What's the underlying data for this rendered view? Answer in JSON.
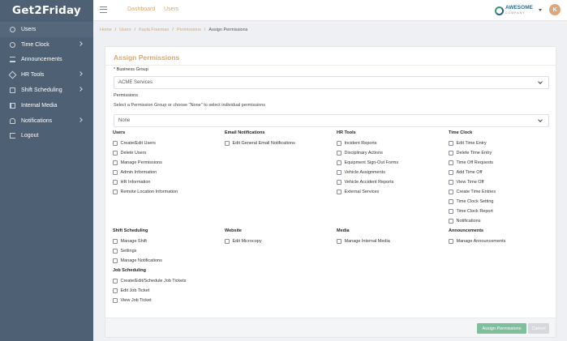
{
  "brand": {
    "name": "Get2Friday"
  },
  "sidebar": {
    "items": [
      {
        "label": "Users",
        "icon": "user-icon"
      },
      {
        "label": "Time Clock",
        "icon": "clock-icon",
        "has_children": true
      },
      {
        "label": "Announcements",
        "icon": "megaphone-icon"
      },
      {
        "label": "HR Tools",
        "icon": "tools-icon",
        "has_children": true
      },
      {
        "label": "Shift Scheduling",
        "icon": "calendar-icon",
        "has_children": true
      },
      {
        "label": "Internal Media",
        "icon": "media-icon"
      },
      {
        "label": "Notifications",
        "icon": "bell-icon",
        "has_children": true
      },
      {
        "label": "Logout",
        "icon": "logout-icon"
      }
    ]
  },
  "topbar": {
    "links": [
      "Dashboard",
      "Users"
    ],
    "company_logo": {
      "name": "AWESOME",
      "tagline": "COMPANY"
    },
    "avatar_initial": "K"
  },
  "breadcrumb": {
    "items": [
      "Home",
      "Users",
      "Kayla Freeman",
      "Permissions"
    ],
    "current": "Assign Permissions"
  },
  "form": {
    "title": "Assign Permissions",
    "business_group_label": "* Business Group",
    "business_group_value": "ACME Services",
    "permissions_label": "Permissions",
    "permissions_hint": "Select a Permission Group or choose \"None\" to select individual permissions",
    "permission_group_value": "None"
  },
  "permission_groups": [
    {
      "title": "Users",
      "items": [
        "Create/Edit Users",
        "Delete Users",
        "Manage Permissions",
        "Admin Information",
        "HR Information",
        "Remote Location Information"
      ]
    },
    {
      "title": "Email Notifications",
      "items": [
        "Edit General Email Notifications"
      ]
    },
    {
      "title": "HR Tools",
      "items": [
        "Incident Reports",
        "Disciplinary Actions",
        "Equipment Sign-Out Forms",
        "Vehicle Assignments",
        "Vehicle Accident Reports",
        "External Services"
      ]
    },
    {
      "title": "Time Clock",
      "items": [
        "Edit Time Entry",
        "Delete Time Entry",
        "Time Off Requests",
        "Add Time Off",
        "View Time Off",
        "Create Time Entries",
        "Time Clock Setting",
        "Time Clock Report",
        "Notifications"
      ]
    },
    {
      "title": "Shift Scheduling",
      "items": [
        "Manage Shift",
        "Settings",
        "Manage Notifications"
      ]
    },
    {
      "title": "Website",
      "items": [
        "Edit Microcopy"
      ]
    },
    {
      "title": "Media",
      "items": [
        "Manage Internal Media"
      ]
    },
    {
      "title": "Announcements",
      "items": [
        "Manage Announcements"
      ]
    },
    {
      "title": "Job Scheduling",
      "items": [
        "Create/Edit/Schedule Job Tickets",
        "Edit Job Ticket",
        "View Job Ticket"
      ]
    }
  ],
  "footer": {
    "assign_label": "Assign Permissions",
    "cancel_label": "Cancel"
  },
  "colors": {
    "sidebar": "#4e6073",
    "accent": "#d6a772",
    "primary_button": "#7fbf9c"
  }
}
